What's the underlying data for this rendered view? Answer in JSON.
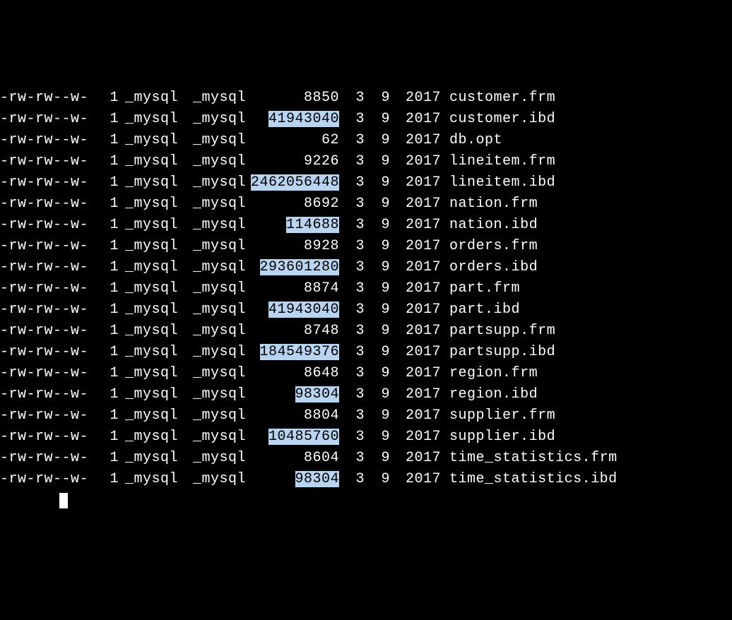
{
  "listing": [
    {
      "perm": "-rw-rw--w-",
      "links": "1",
      "owner": "_mysql",
      "group": "_mysql",
      "size": "8850",
      "hl": false,
      "month": "3",
      "day": "9",
      "year": "2017",
      "name": "customer.frm"
    },
    {
      "perm": "-rw-rw--w-",
      "links": "1",
      "owner": "_mysql",
      "group": "_mysql",
      "size": "41943040",
      "hl": true,
      "month": "3",
      "day": "9",
      "year": "2017",
      "name": "customer.ibd"
    },
    {
      "perm": "-rw-rw--w-",
      "links": "1",
      "owner": "_mysql",
      "group": "_mysql",
      "size": "62",
      "hl": false,
      "month": "3",
      "day": "9",
      "year": "2017",
      "name": "db.opt"
    },
    {
      "perm": "-rw-rw--w-",
      "links": "1",
      "owner": "_mysql",
      "group": "_mysql",
      "size": "9226",
      "hl": false,
      "month": "3",
      "day": "9",
      "year": "2017",
      "name": "lineitem.frm"
    },
    {
      "perm": "-rw-rw--w-",
      "links": "1",
      "owner": "_mysql",
      "group": "_mysql",
      "size": "2462056448",
      "hl": true,
      "month": "3",
      "day": "9",
      "year": "2017",
      "name": "lineitem.ibd"
    },
    {
      "perm": "-rw-rw--w-",
      "links": "1",
      "owner": "_mysql",
      "group": "_mysql",
      "size": "8692",
      "hl": false,
      "month": "3",
      "day": "9",
      "year": "2017",
      "name": "nation.frm"
    },
    {
      "perm": "-rw-rw--w-",
      "links": "1",
      "owner": "_mysql",
      "group": "_mysql",
      "size": "114688",
      "hl": true,
      "month": "3",
      "day": "9",
      "year": "2017",
      "name": "nation.ibd"
    },
    {
      "perm": "-rw-rw--w-",
      "links": "1",
      "owner": "_mysql",
      "group": "_mysql",
      "size": "8928",
      "hl": false,
      "month": "3",
      "day": "9",
      "year": "2017",
      "name": "orders.frm"
    },
    {
      "perm": "-rw-rw--w-",
      "links": "1",
      "owner": "_mysql",
      "group": "_mysql",
      "size": "293601280",
      "hl": true,
      "month": "3",
      "day": "9",
      "year": "2017",
      "name": "orders.ibd"
    },
    {
      "perm": "-rw-rw--w-",
      "links": "1",
      "owner": "_mysql",
      "group": "_mysql",
      "size": "8874",
      "hl": false,
      "month": "3",
      "day": "9",
      "year": "2017",
      "name": "part.frm"
    },
    {
      "perm": "-rw-rw--w-",
      "links": "1",
      "owner": "_mysql",
      "group": "_mysql",
      "size": "41943040",
      "hl": true,
      "month": "3",
      "day": "9",
      "year": "2017",
      "name": "part.ibd"
    },
    {
      "perm": "-rw-rw--w-",
      "links": "1",
      "owner": "_mysql",
      "group": "_mysql",
      "size": "8748",
      "hl": false,
      "month": "3",
      "day": "9",
      "year": "2017",
      "name": "partsupp.frm"
    },
    {
      "perm": "-rw-rw--w-",
      "links": "1",
      "owner": "_mysql",
      "group": "_mysql",
      "size": "184549376",
      "hl": true,
      "month": "3",
      "day": "9",
      "year": "2017",
      "name": "partsupp.ibd"
    },
    {
      "perm": "-rw-rw--w-",
      "links": "1",
      "owner": "_mysql",
      "group": "_mysql",
      "size": "8648",
      "hl": false,
      "month": "3",
      "day": "9",
      "year": "2017",
      "name": "region.frm"
    },
    {
      "perm": "-rw-rw--w-",
      "links": "1",
      "owner": "_mysql",
      "group": "_mysql",
      "size": "98304",
      "hl": true,
      "month": "3",
      "day": "9",
      "year": "2017",
      "name": "region.ibd"
    },
    {
      "perm": "-rw-rw--w-",
      "links": "1",
      "owner": "_mysql",
      "group": "_mysql",
      "size": "8804",
      "hl": false,
      "month": "3",
      "day": "9",
      "year": "2017",
      "name": "supplier.frm"
    },
    {
      "perm": "-rw-rw--w-",
      "links": "1",
      "owner": "_mysql",
      "group": "_mysql",
      "size": "10485760",
      "hl": true,
      "month": "3",
      "day": "9",
      "year": "2017",
      "name": "supplier.ibd"
    },
    {
      "perm": "-rw-rw--w-",
      "links": "1",
      "owner": "_mysql",
      "group": "_mysql",
      "size": "8604",
      "hl": false,
      "month": "3",
      "day": "9",
      "year": "2017",
      "name": "time_statistics.frm"
    },
    {
      "perm": "-rw-rw--w-",
      "links": "1",
      "owner": "_mysql",
      "group": "_mysql",
      "size": "98304",
      "hl": true,
      "month": "3",
      "day": "9",
      "year": "2017",
      "name": "time_statistics.ibd"
    }
  ]
}
